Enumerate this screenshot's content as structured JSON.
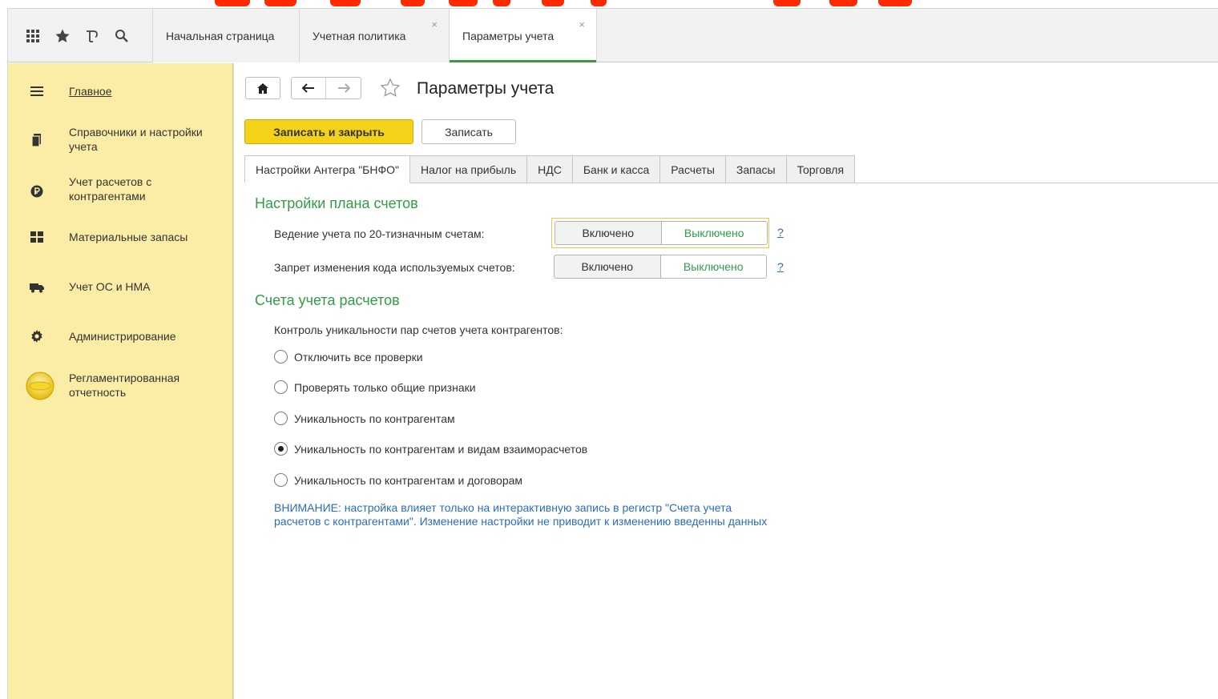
{
  "top_tabs": [
    {
      "label": "Начальная страница",
      "active": false,
      "closable": false
    },
    {
      "label": "Учетная политика",
      "active": false,
      "closable": true
    },
    {
      "label": "Параметры учета",
      "active": true,
      "closable": true
    }
  ],
  "top_icons": [
    "apps-grid-icon",
    "favorites-star-icon",
    "history-icon",
    "search-icon"
  ],
  "sidebar": {
    "items": [
      {
        "label": "Главное",
        "icon": "hamburger-menu-icon",
        "underline": true
      },
      {
        "label": "Справочники и настройки учета",
        "icon": "books-icon"
      },
      {
        "label": "Учет расчетов с контрагентами",
        "icon": "ruble-coin-icon"
      },
      {
        "label": "Материальные запасы",
        "icon": "inventory-grid-icon"
      },
      {
        "label": "Учет ОС и НМА",
        "icon": "truck-icon"
      },
      {
        "label": "Администрирование",
        "icon": "gear-icon"
      },
      {
        "label": "Регламентированная отчетность",
        "icon": "report-disc-icon"
      }
    ]
  },
  "page": {
    "title": "Параметры учета",
    "buttons": {
      "save_close": "Записать и закрыть",
      "save": "Записать"
    },
    "tabs": [
      "Настройки Антегра \"БНФО\"",
      "Налог на прибыль",
      "НДС",
      "Банк и касса",
      "Расчеты",
      "Запасы",
      "Торговля"
    ],
    "active_tab": 0,
    "sections": {
      "chart_of_accounts": {
        "title": "Настройки плана счетов",
        "fields": [
          {
            "label": "Ведение учета по 20-тизначным счетам:",
            "on": "Включено",
            "off": "Выключено",
            "value": "Выключено",
            "help": "?"
          },
          {
            "label": "Запрет изменения кода используемых счетов:",
            "on": "Включено",
            "off": "Выключено",
            "value": "Выключено",
            "help": "?"
          }
        ]
      },
      "settlement_accounts": {
        "title": "Счета учета расчетов",
        "prompt": "Контроль уникальности пар счетов учета контрагентов:",
        "options": [
          "Отключить все проверки",
          "Проверять только общие признаки",
          "Уникальность по контрагентам",
          "Уникальность по контрагентам и видам взаиморасчетов",
          "Уникальность по контрагентам и договорам"
        ],
        "selected_index": 3,
        "notice": "ВНИМАНИЕ: настройка влияет только на интерактивную запись в регистр \"Счета учета расчетов с контрагентами\". Изменение настройки не приводит к изменению введенны данных"
      }
    }
  },
  "colors": {
    "sidebar_bg": "#fbeda5",
    "primary_button": "#f5d21a",
    "section_title": "#2f9e44",
    "link": "#2a6ebb",
    "banner": "#ff2a00"
  }
}
